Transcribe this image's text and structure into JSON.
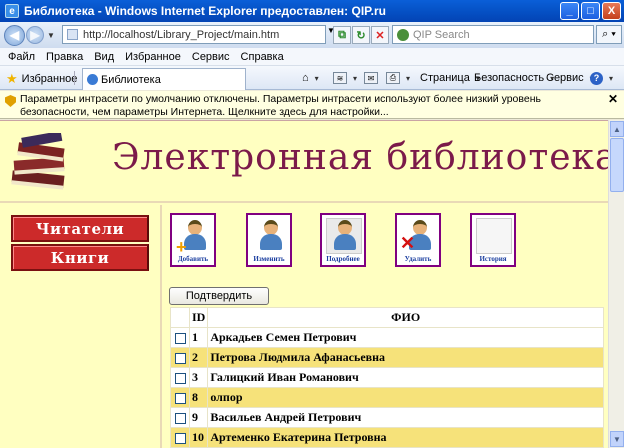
{
  "window": {
    "title": "Библиотека - Windows Internet Explorer предоставлен: QIP.ru",
    "buttons": [
      "_",
      "□",
      "X"
    ]
  },
  "address": {
    "url": "http://localhost/Library_Project/main.htm",
    "search_placeholder": "QIP Search"
  },
  "menu": [
    "Файл",
    "Правка",
    "Вид",
    "Избранное",
    "Сервис",
    "Справка"
  ],
  "favbar": {
    "favorites": "Избранное",
    "tab": "Библиотека",
    "commands": [
      "Страница",
      "Безопасность",
      "Сервис"
    ]
  },
  "infobar": {
    "text": "Параметры интрасети по умолчанию отключены. Параметры интрасети используют более низкий уровень безопасности, чем параметры Интернета. Щелкните здесь для настройки..."
  },
  "page": {
    "title": "Электронная библиотека",
    "nav": [
      "Читатели",
      "Книги"
    ],
    "actions": [
      "Добавить",
      "Изменить",
      "Подробнее",
      "Удалить",
      "История"
    ],
    "submit_label": "Подтвердить",
    "table": {
      "headers": [
        "ID",
        "ФИО"
      ],
      "rows": [
        {
          "id": "1",
          "name": "Аркадьев Семен Петрович"
        },
        {
          "id": "2",
          "name": "Петрова Людмила Афанасьевна"
        },
        {
          "id": "3",
          "name": "Галицкий Иван Романович"
        },
        {
          "id": "8",
          "name": "олпор"
        },
        {
          "id": "9",
          "name": "Васильев Андрей Петрович"
        },
        {
          "id": "10",
          "name": "Артеменко Екатерина Петровна"
        }
      ]
    }
  },
  "colors": {
    "page_bg": "#ffffc1",
    "title_color": "#7b1a4a",
    "nav_button": "#cc2a2a",
    "row_highlight": "#f6e27a"
  }
}
